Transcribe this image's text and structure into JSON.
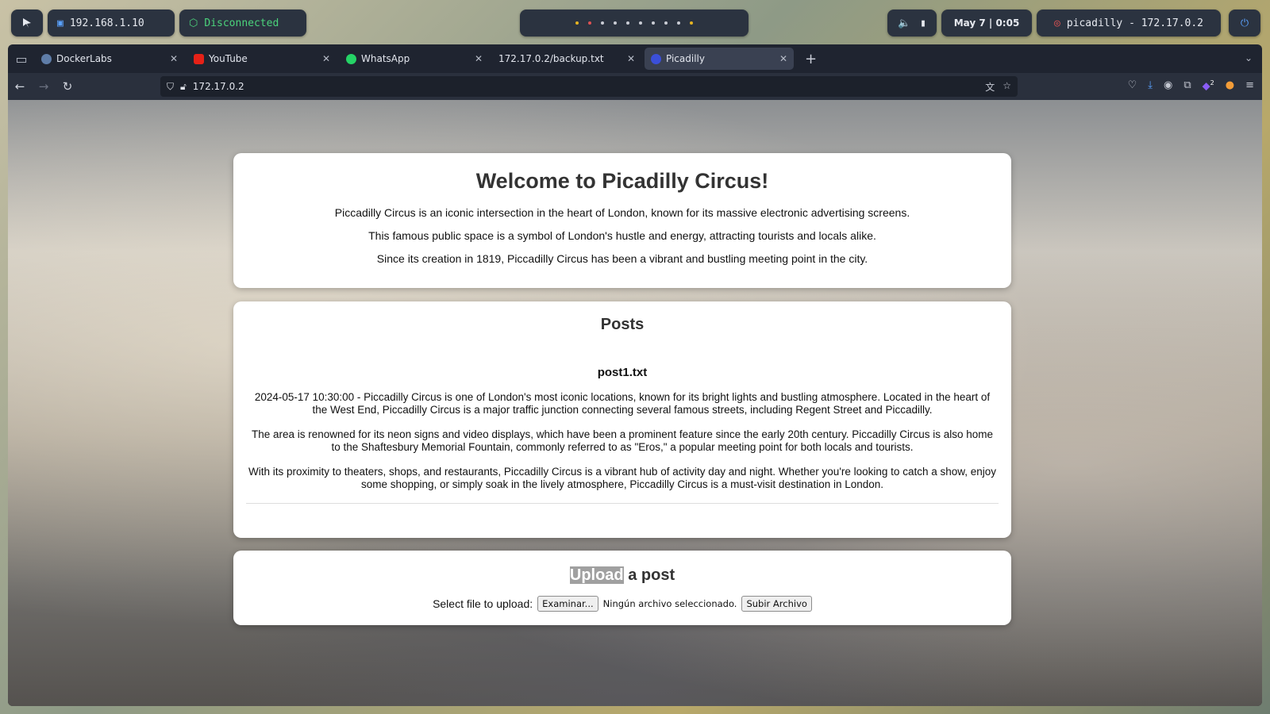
{
  "system_bar": {
    "ip": "192.168.1.10",
    "vpn_status": "Disconnected",
    "clock": "May 7 | 0:05",
    "target": "picadilly - 172.17.0.2"
  },
  "browser": {
    "tabs": [
      {
        "label": "DockerLabs"
      },
      {
        "label": "YouTube"
      },
      {
        "label": "WhatsApp"
      },
      {
        "label": "172.17.0.2/backup.txt"
      },
      {
        "label": "Picadilly"
      }
    ],
    "url": "172.17.0.2",
    "extension_badge": "2"
  },
  "page": {
    "welcome": {
      "title": "Welcome to Picadilly Circus!",
      "p1": "Piccadilly Circus is an iconic intersection in the heart of London, known for its massive electronic advertising screens.",
      "p2": "This famous public space is a symbol of London's hustle and energy, attracting tourists and locals alike.",
      "p3": "Since its creation in 1819, Piccadilly Circus has been a vibrant and bustling meeting point in the city."
    },
    "posts": {
      "heading": "Posts",
      "items": [
        {
          "title": "post1.txt",
          "p1": "2024-05-17 10:30:00 - Piccadilly Circus is one of London's most iconic locations, known for its bright lights and bustling atmosphere. Located in the heart of the West End, Piccadilly Circus is a major traffic junction connecting several famous streets, including Regent Street and Piccadilly.",
          "p2": "The area is renowned for its neon signs and video displays, which have been a prominent feature since the early 20th century. Piccadilly Circus is also home to the Shaftesbury Memorial Fountain, commonly referred to as \"Eros,\" a popular meeting point for both locals and tourists.",
          "p3": "With its proximity to theaters, shops, and restaurants, Piccadilly Circus is a vibrant hub of activity day and night. Whether you're looking to catch a show, enjoy some shopping, or simply soak in the lively atmosphere, Piccadilly Circus is a must-visit destination in London."
        }
      ]
    },
    "upload": {
      "heading_highlight": "Upload",
      "heading_rest": " a post",
      "label": "Select file to upload:",
      "browse_button": "Examinar...",
      "no_file_text": "Ningún archivo seleccionado.",
      "submit_button": "Subir Archivo"
    }
  }
}
